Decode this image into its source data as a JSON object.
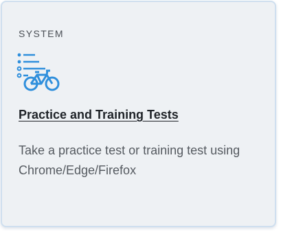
{
  "card": {
    "category": "SYSTEM",
    "icon": "checklist-bicycle-icon",
    "title": "Practice and Training Tests",
    "description": "Take a practice test or training test using Chrome/Edge/Firefox"
  },
  "colors": {
    "accent": "#2f8fdc",
    "card_background": "#eef1f4",
    "card_border": "#cfdfef"
  }
}
